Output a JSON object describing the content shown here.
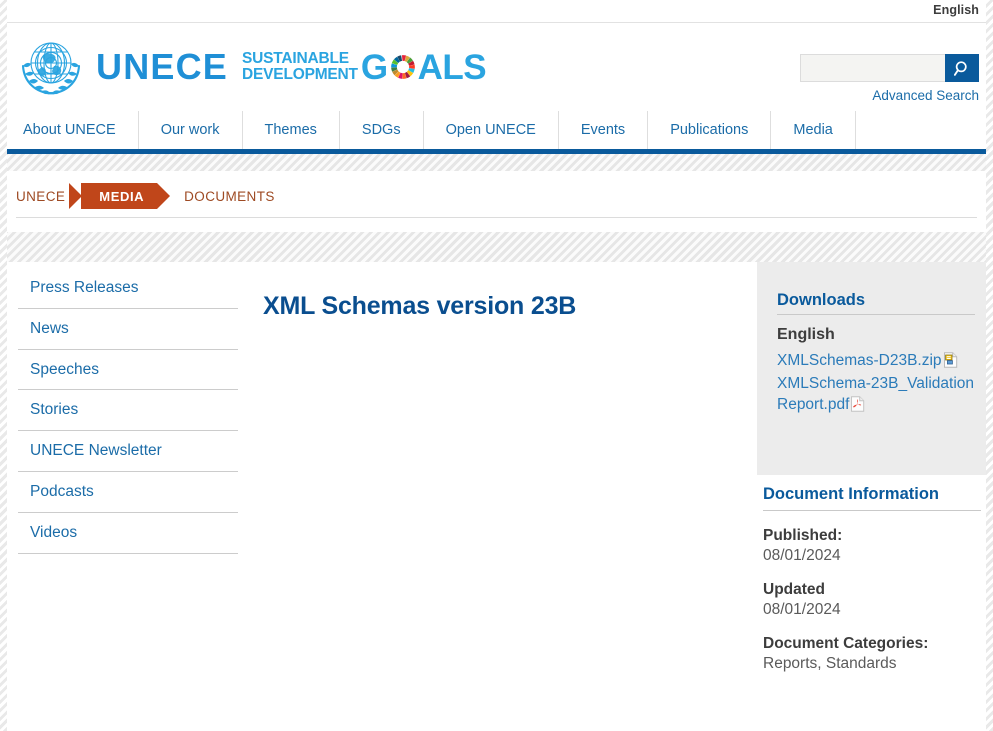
{
  "topbar": {
    "language": "English"
  },
  "brand": {
    "name": "UNECE",
    "sdg_line1": "SUSTAINABLE",
    "sdg_line2": "DEVELOPMENT",
    "sdg_g": "G",
    "sdg_als": "ALS",
    "un_emblem_icon": "un-emblem-icon",
    "sdg_wheel_icon": "sdg-color-wheel-icon"
  },
  "search": {
    "value": "",
    "placeholder": "",
    "icon": "search-icon",
    "advanced_label": "Advanced Search"
  },
  "nav": {
    "items": [
      {
        "label": "About UNECE"
      },
      {
        "label": "Our work"
      },
      {
        "label": "Themes"
      },
      {
        "label": "SDGs"
      },
      {
        "label": "Open UNECE"
      },
      {
        "label": "Events"
      },
      {
        "label": "Publications"
      },
      {
        "label": "Media"
      }
    ]
  },
  "breadcrumb": {
    "root": "UNECE",
    "current": "MEDIA",
    "leaf": "DOCUMENTS"
  },
  "sidebar": {
    "items": [
      {
        "label": "Press Releases"
      },
      {
        "label": "News"
      },
      {
        "label": "Speeches"
      },
      {
        "label": "Stories"
      },
      {
        "label": "UNECE Newsletter"
      },
      {
        "label": "Podcasts"
      },
      {
        "label": "Videos"
      }
    ]
  },
  "main": {
    "title": "XML Schemas version 23B"
  },
  "downloads": {
    "heading": "Downloads",
    "language": "English",
    "files": [
      {
        "name": "XMLSchemas-D23B.zip",
        "icon": "zip-file-icon"
      },
      {
        "name": "XMLSchema-23B_ValidationReport.pdf",
        "icon": "pdf-file-icon"
      }
    ]
  },
  "document_information": {
    "heading": "Document Information",
    "fields": [
      {
        "label": "Published:",
        "value": "08/01/2024"
      },
      {
        "label": "Updated",
        "value": "08/01/2024"
      },
      {
        "label": "Document Categories:",
        "value": "Reports, Standards"
      }
    ]
  },
  "colors": {
    "unece_blue": "#1f8fd6",
    "nav_blue": "#1b6ca8",
    "bar_blue": "#0a5a9c",
    "title_blue": "#0a4e8f",
    "breadcrumb_orange": "#c0461a",
    "panel_gray": "#ececec"
  }
}
